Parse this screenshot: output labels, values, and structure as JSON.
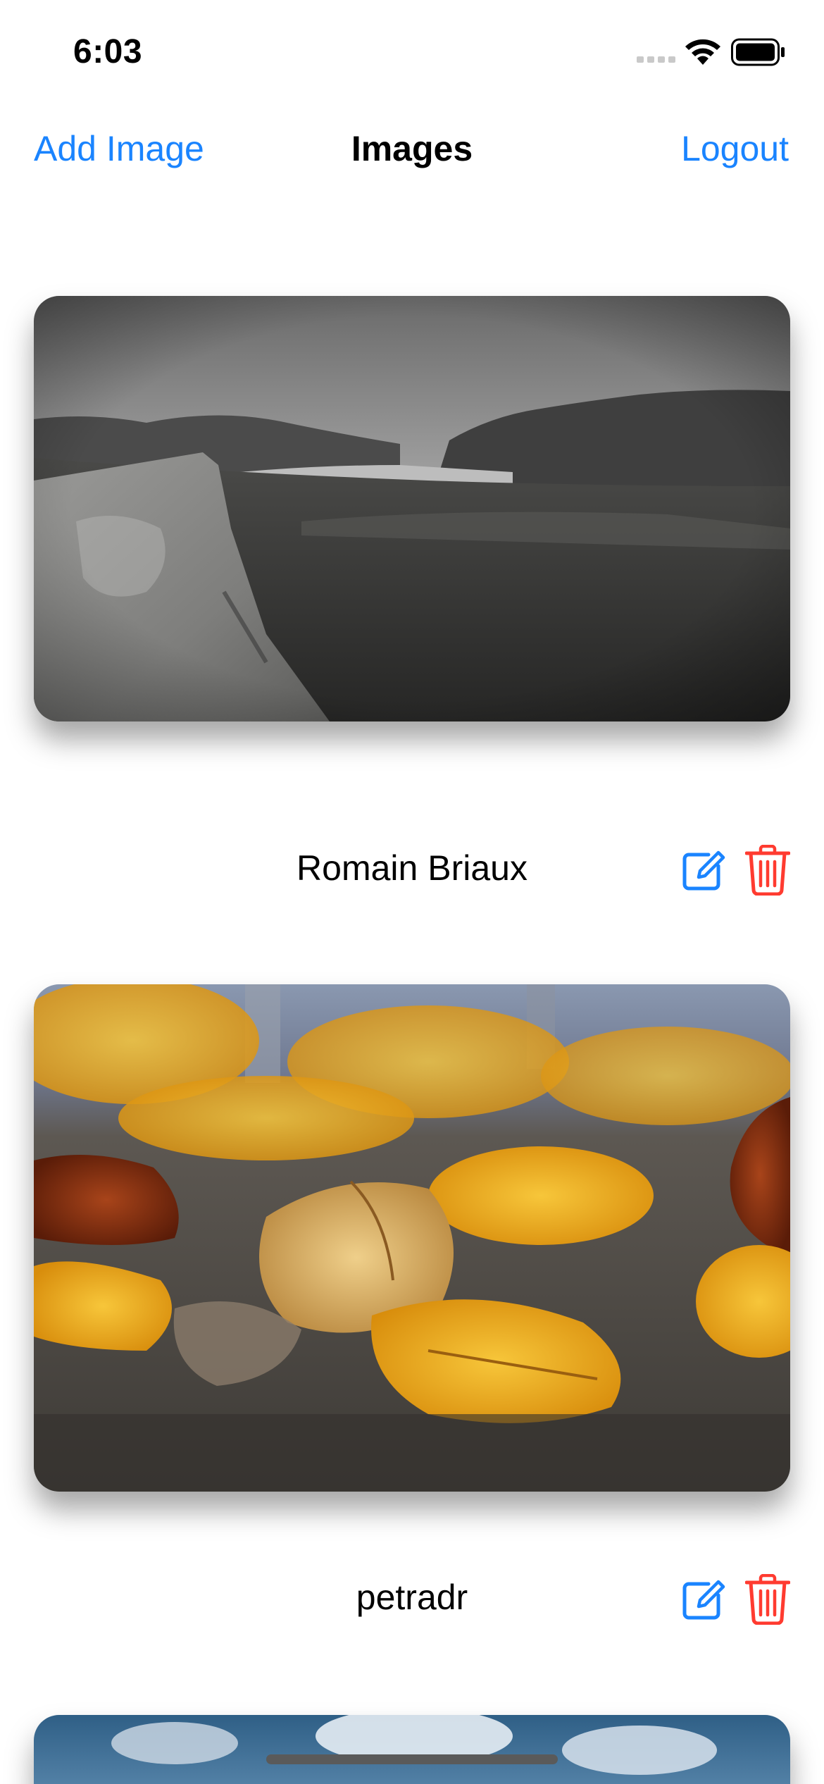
{
  "status_bar": {
    "time": "6:03",
    "icons": [
      "cellular-signal-icon",
      "wifi-icon",
      "battery-icon"
    ]
  },
  "nav_bar": {
    "left_button": "Add Image",
    "title": "Images",
    "right_button": "Logout"
  },
  "colors": {
    "accent_blue": "#1a84ff",
    "delete_red": "#ff3b30",
    "background": "#ffffff"
  },
  "feed": {
    "items": [
      {
        "author": "Romain Briaux",
        "image": "black-and-white mountain landscape with lake and rock",
        "actions": [
          "edit-icon",
          "trash-icon"
        ]
      },
      {
        "author": "petradr",
        "image": "close-up of yellow autumn leaves on ground",
        "actions": [
          "edit-icon",
          "trash-icon"
        ]
      },
      {
        "image": "sky with clouds (partially visible)"
      }
    ]
  }
}
